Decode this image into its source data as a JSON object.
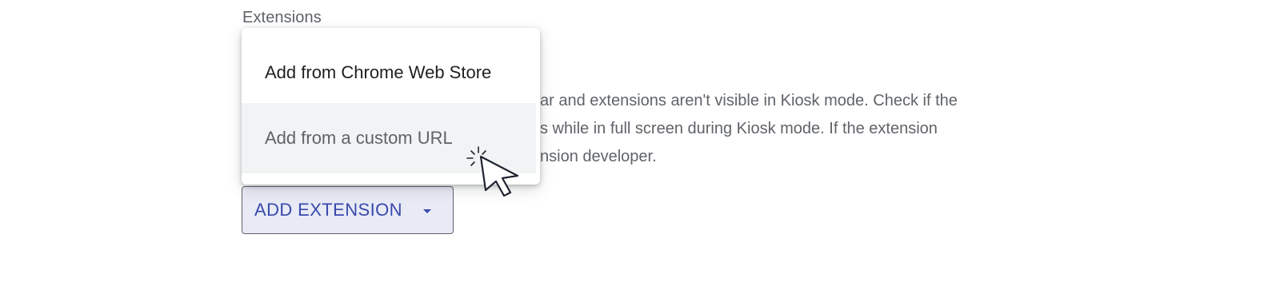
{
  "section": {
    "title": "Extensions"
  },
  "description": {
    "line1": "ar and extensions aren't visible in Kiosk mode. Check if the",
    "line2": "s while in full screen during Kiosk mode. If the extension",
    "line3": "nsion developer."
  },
  "menu": {
    "items": [
      {
        "label": "Add from Chrome Web Store"
      },
      {
        "label": "Add from a custom URL"
      }
    ]
  },
  "add_extension": {
    "label": "ADD EXTENSION"
  },
  "colors": {
    "accent": "#3949ab",
    "button_bg": "#e8eaf6",
    "hover_bg": "#f1f3f4",
    "text_secondary": "#5f6368"
  },
  "icons": {
    "cursor": "pointer-cursor-icon",
    "caret": "caret-down-icon"
  }
}
